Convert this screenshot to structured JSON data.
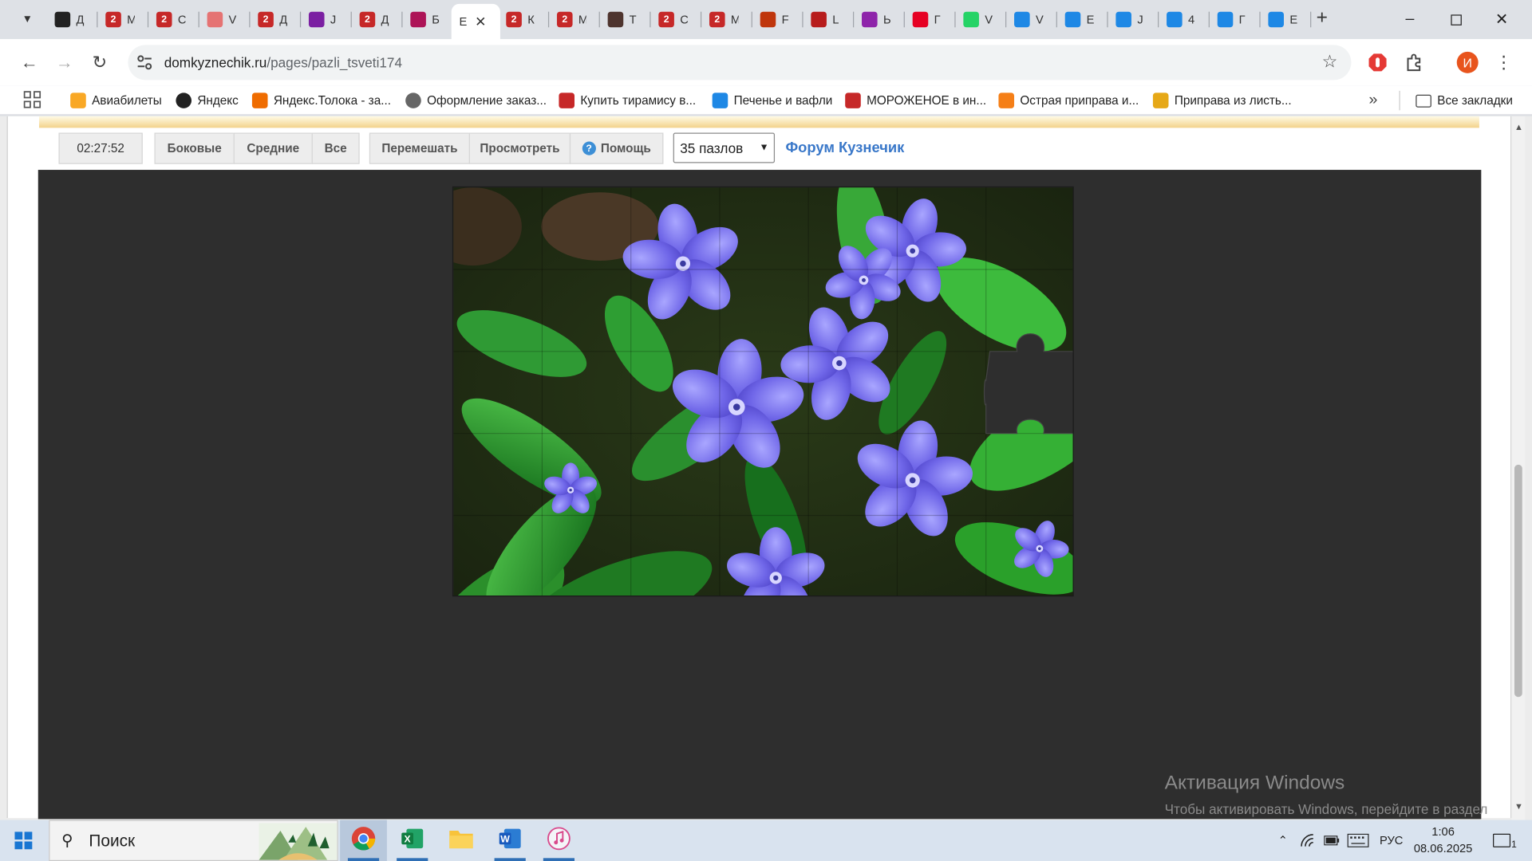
{
  "browser": {
    "tabs": [
      {
        "name": "tab-yandex",
        "icon": "yandex-icon",
        "label": "Д",
        "color": "#222"
      },
      {
        "name": "tab-puzzle-1",
        "icon": "puzzle-site-icon",
        "label": "М",
        "color": "#c62828"
      },
      {
        "name": "tab-puzzle-2",
        "icon": "puzzle-site-icon",
        "label": "С",
        "color": "#c62828"
      },
      {
        "name": "tab-pinwheel",
        "icon": "site-icon",
        "label": "V",
        "color": "#e57373"
      },
      {
        "name": "tab-puzzle-3",
        "icon": "puzzle-site-icon",
        "label": "Д",
        "color": "#c62828"
      },
      {
        "name": "tab-grid",
        "icon": "grid-site-icon",
        "label": "J",
        "color": "#7b1fa2"
      },
      {
        "name": "tab-puzzle-4",
        "icon": "puzzle-site-icon",
        "label": "Д",
        "color": "#c62828"
      },
      {
        "name": "tab-flower",
        "icon": "flower-site-icon",
        "label": "Б",
        "color": "#ad1457"
      },
      {
        "name": "tab-active",
        "icon": "page-icon",
        "label": "Е",
        "color": "#ffffff",
        "active": true
      },
      {
        "name": "tab-puzzle-5",
        "icon": "puzzle-site-icon",
        "label": "К",
        "color": "#c62828"
      },
      {
        "name": "tab-puzzle-6",
        "icon": "puzzle-site-icon",
        "label": "М",
        "color": "#c62828"
      },
      {
        "name": "tab-dark",
        "icon": "site-icon",
        "label": "Т",
        "color": "#4e342e"
      },
      {
        "name": "tab-puzzle-7",
        "icon": "puzzle-site-icon",
        "label": "С",
        "color": "#c62828"
      },
      {
        "name": "tab-puzzle-8",
        "icon": "puzzle-site-icon",
        "label": "М",
        "color": "#c62828"
      },
      {
        "name": "tab-fox",
        "icon": "site-icon",
        "label": "F",
        "color": "#bf360c"
      },
      {
        "name": "tab-red",
        "icon": "site-icon",
        "label": "L",
        "color": "#b71c1c"
      },
      {
        "name": "tab-wb",
        "icon": "wildberries-icon",
        "label": "Ы",
        "color": "#8e24aa"
      },
      {
        "name": "tab-pinterest",
        "icon": "pinterest-icon",
        "label": "Г",
        "color": "#e60023"
      },
      {
        "name": "tab-whatsapp",
        "icon": "whatsapp-icon",
        "label": "V",
        "color": "#25d366"
      },
      {
        "name": "tab-blue-1",
        "icon": "site-icon",
        "label": "V",
        "color": "#1e88e5"
      },
      {
        "name": "tab-blue-2",
        "icon": "site-icon",
        "label": "Е",
        "color": "#1e88e5"
      },
      {
        "name": "tab-blue-3",
        "icon": "site-icon",
        "label": "Ј",
        "color": "#1e88e5"
      },
      {
        "name": "tab-blue-4",
        "icon": "site-icon",
        "label": "4",
        "color": "#1e88e5"
      },
      {
        "name": "tab-blue-5",
        "icon": "site-icon",
        "label": "Г",
        "color": "#1e88e5"
      },
      {
        "name": "tab-blue-6",
        "icon": "site-icon",
        "label": "Е",
        "color": "#1e88e5"
      }
    ],
    "url_host": "domkyznechik.ru",
    "url_path": "/pages/pazli_tsveti174",
    "bookmarks": [
      {
        "label": "Авиабилеты",
        "icon": "flights-icon",
        "color": "#f9a825"
      },
      {
        "label": "Яндекс",
        "icon": "yandex-icon",
        "color": "#222"
      },
      {
        "label": "Яндекс.Толока - за...",
        "icon": "toloka-icon",
        "color": "#ef6c00"
      },
      {
        "label": "Оформление заказ...",
        "icon": "globe-icon",
        "color": "#666"
      },
      {
        "label": "Купить тирамису в...",
        "icon": "tiramisu-icon",
        "color": "#c62828"
      },
      {
        "label": "Печенье и вафли",
        "icon": "cookie-icon",
        "color": "#1e88e5"
      },
      {
        "label": "МОРОЖЕНОЕ в ин...",
        "icon": "shop-icon",
        "color": "#c62828"
      },
      {
        "label": "Острая приправа и...",
        "icon": "spice-icon",
        "color": "#f57f17"
      },
      {
        "label": "Приправа из листь...",
        "icon": "leaf-icon",
        "color": "#e6a817"
      }
    ],
    "all_bookmarks": "Все закладки",
    "profile_letter": "И"
  },
  "puzzle_page": {
    "timer": "02:27:52",
    "filters": [
      "Боковые",
      "Средние",
      "Все"
    ],
    "actions": [
      "Перемешать",
      "Просмотреть",
      "Помощь"
    ],
    "pieces_select": "35 пазлов",
    "forum_link": "Форум Кузнечик",
    "puzzle": {
      "cols": 7,
      "rows": 5,
      "missing_piece": {
        "col": 6,
        "row": 2
      }
    }
  },
  "watermark": {
    "title": "Активация Windows",
    "subtitle": "Чтобы активировать Windows, перейдите в раздел \"Параметры\"."
  },
  "taskbar": {
    "search_placeholder": "Поиск",
    "apps": [
      {
        "name": "chrome-app",
        "icon": "chrome-icon",
        "active": true
      },
      {
        "name": "excel-app",
        "icon": "excel-icon",
        "active": true
      },
      {
        "name": "explorer-app",
        "icon": "folder-icon",
        "active": false
      },
      {
        "name": "word-app",
        "icon": "word-icon",
        "active": true
      },
      {
        "name": "itunes-app",
        "icon": "itunes-icon",
        "active": true
      }
    ],
    "language": "РУС",
    "time": "1:06",
    "date": "08.06.2025",
    "notification_count": "1"
  }
}
